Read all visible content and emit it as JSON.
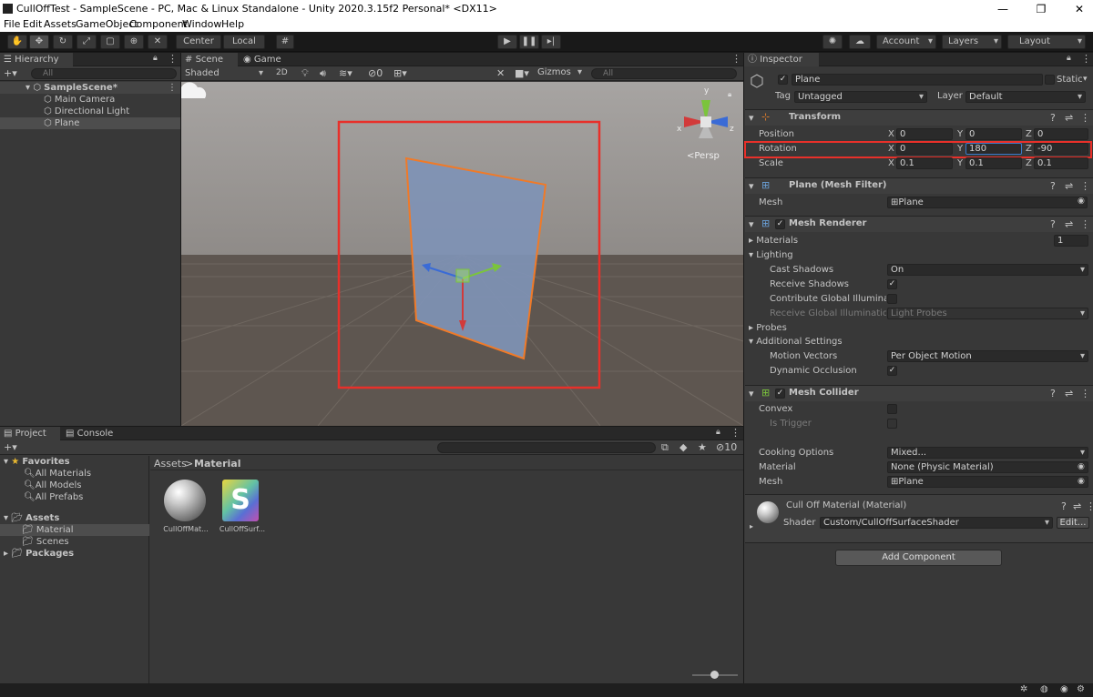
{
  "window": {
    "title": "CullOffTest - SampleScene - PC, Mac & Linux Standalone - Unity 2020.3.15f2 Personal* <DX11>",
    "min": "—",
    "max": "❐",
    "close": "✕"
  },
  "menu": [
    "File",
    "Edit",
    "Assets",
    "GameObject",
    "Component",
    "Window",
    "Help"
  ],
  "toolbar": {
    "pivot_center": "Center",
    "pivot_local": "Local",
    "account": "Account",
    "layers": "Layers",
    "layout": "Layout"
  },
  "hierarchy": {
    "tab": "Hierarchy",
    "add": "+▾",
    "search_placeholder": "All",
    "scene": "SampleScene*",
    "items": [
      "Main Camera",
      "Directional Light",
      "Plane"
    ]
  },
  "scene": {
    "tab_scene": "Scene",
    "tab_game": "Game",
    "shading": "Shaded",
    "mode_2d": "2D",
    "hidden_count": "0",
    "gizmos": "Gizmos",
    "search_placeholder": "All",
    "persp": "<Persp",
    "axis_x": "x",
    "axis_y": "y",
    "axis_z": "z"
  },
  "project": {
    "tab_project": "Project",
    "tab_console": "Console",
    "add": "+▾",
    "favorites": "Favorites",
    "fav_items": [
      "All Materials",
      "All Models",
      "All Prefabs"
    ],
    "assets": "Assets",
    "asset_items": [
      "Material",
      "Scenes"
    ],
    "packages": "Packages",
    "breadcrumb_root": "Assets",
    "breadcrumb_sep": ">",
    "breadcrumb_current": "Material",
    "hidden_count": "10",
    "files": [
      {
        "name": "CullOffMat...",
        "kind": "material"
      },
      {
        "name": "CullOffSurf...",
        "kind": "shader",
        "glyph": "S"
      }
    ]
  },
  "inspector": {
    "tab": "Inspector",
    "object_name": "Plane",
    "static": "Static",
    "tag_label": "Tag",
    "tag_value": "Untagged",
    "layer_label": "Layer",
    "layer_value": "Default",
    "transform": {
      "title": "Transform",
      "position_label": "Position",
      "rotation_label": "Rotation",
      "scale_label": "Scale",
      "axes": [
        "X",
        "Y",
        "Z"
      ],
      "position": [
        "0",
        "0",
        "0"
      ],
      "rotation": [
        "0",
        "180",
        "-90"
      ],
      "scale": [
        "0.1",
        "0.1",
        "0.1"
      ]
    },
    "mesh_filter": {
      "title": "Plane (Mesh Filter)",
      "mesh_label": "Mesh",
      "mesh_value": "Plane"
    },
    "mesh_renderer": {
      "title": "Mesh Renderer",
      "materials_label": "Materials",
      "materials_count": "1",
      "lighting_label": "Lighting",
      "cast_shadows_label": "Cast Shadows",
      "cast_shadows_value": "On",
      "receive_shadows_label": "Receive Shadows",
      "contribute_gi_label": "Contribute Global Illuminati",
      "receive_gi_label": "Receive Global Illumination",
      "receive_gi_value": "Light Probes",
      "probes_label": "Probes",
      "additional_label": "Additional Settings",
      "motion_vectors_label": "Motion Vectors",
      "motion_vectors_value": "Per Object Motion",
      "dynamic_occlusion_label": "Dynamic Occlusion"
    },
    "mesh_collider": {
      "title": "Mesh Collider",
      "convex_label": "Convex",
      "is_trigger_label": "Is Trigger",
      "cooking_label": "Cooking Options",
      "cooking_value": "Mixed...",
      "material_label": "Material",
      "material_value": "None (Physic Material)",
      "mesh_label": "Mesh",
      "mesh_value": "Plane"
    },
    "material": {
      "title": "Cull Off Material (Material)",
      "shader_label": "Shader",
      "shader_value": "Custom/CullOffSurfaceShader",
      "edit": "Edit..."
    },
    "add_component": "Add Component"
  },
  "colors": {
    "selection_outline": "#e8302a",
    "plane_fill": "#7f92b5",
    "plane_outline": "#f07a28",
    "accent_check": "#dddddd"
  }
}
